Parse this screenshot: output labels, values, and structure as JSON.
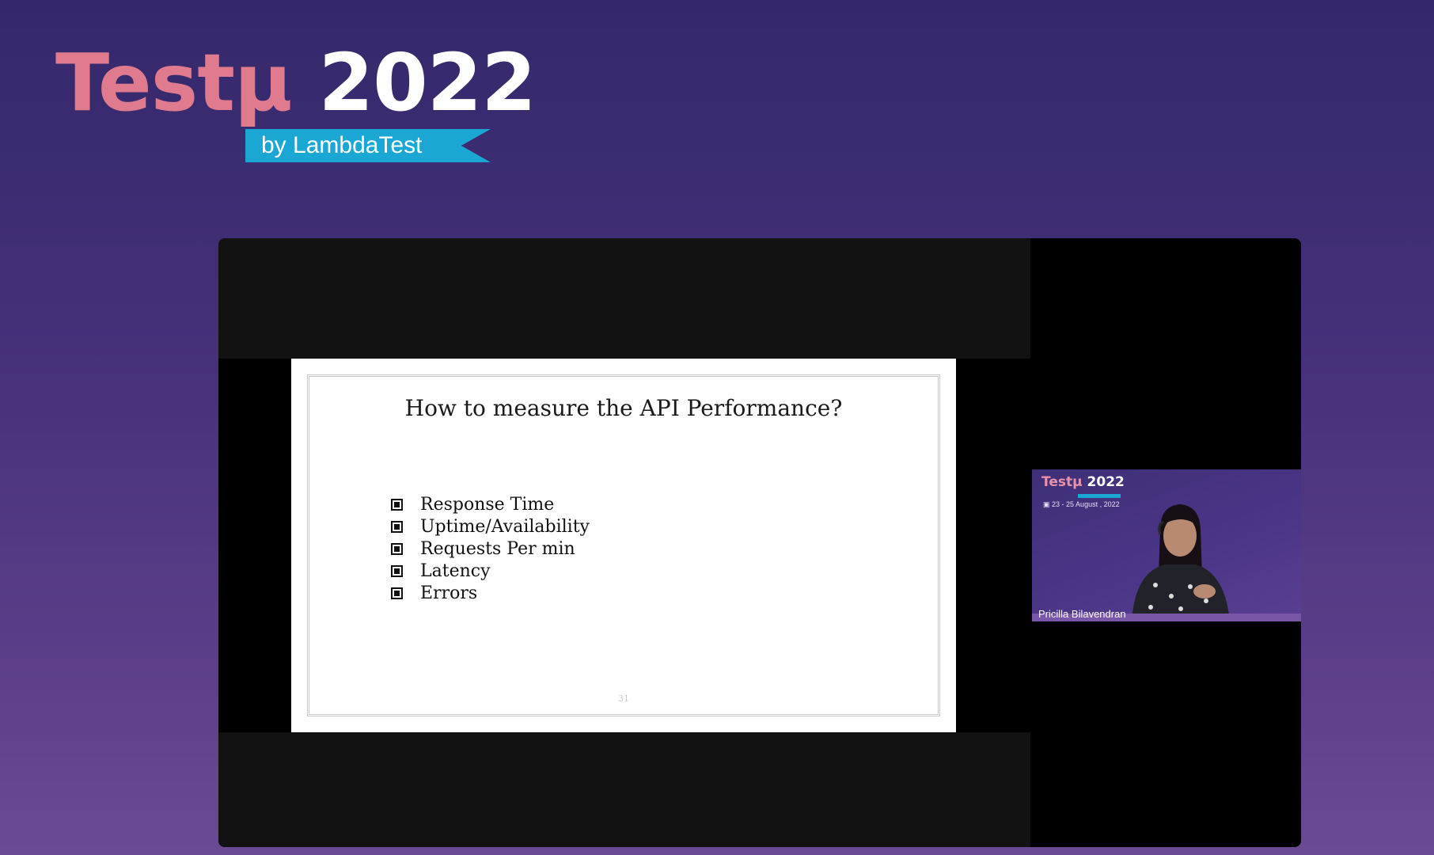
{
  "brand": {
    "title_part1": "Testμ",
    "title_part2": "2022",
    "ribbon": "by LambdaTest"
  },
  "slide": {
    "title": "How to measure the API Performance?",
    "bullets": [
      "Response Time",
      "Uptime/Availability",
      "Requests Per min",
      "Latency",
      "Errors"
    ],
    "page_number": "31"
  },
  "speaker_tile": {
    "brand_part1": "Testμ",
    "brand_part2": "2022",
    "date": "23 - 25 August , 2022",
    "name": "Pricilla Bilavendran"
  },
  "colors": {
    "background_top": "#34286a",
    "background_bottom": "#6a4a93",
    "brand_pink": "#e07a8f",
    "ribbon_blue": "#1ba7d3"
  }
}
